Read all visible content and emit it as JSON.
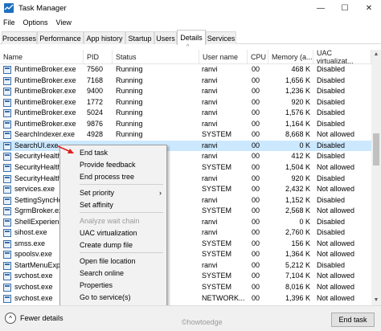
{
  "window": {
    "title": "Task Manager",
    "minimize": "—",
    "maximize": "☐",
    "close": "✕"
  },
  "menu": [
    "File",
    "Options",
    "View"
  ],
  "tabs": [
    "Processes",
    "Performance",
    "App history",
    "Startup",
    "Users",
    "Details",
    "Services"
  ],
  "active_tab": "Details",
  "columns": [
    "Name",
    "PID",
    "Status",
    "User name",
    "CPU",
    "Memory (a...",
    "UAC virtualizat..."
  ],
  "rows": [
    {
      "name": "RuntimeBroker.exe",
      "pid": "7560",
      "status": "Running",
      "user": "ranvi",
      "cpu": "00",
      "mem": "468 K",
      "uac": "Disabled"
    },
    {
      "name": "RuntimeBroker.exe",
      "pid": "7168",
      "status": "Running",
      "user": "ranvi",
      "cpu": "00",
      "mem": "1,656 K",
      "uac": "Disabled"
    },
    {
      "name": "RuntimeBroker.exe",
      "pid": "9400",
      "status": "Running",
      "user": "ranvi",
      "cpu": "00",
      "mem": "1,236 K",
      "uac": "Disabled"
    },
    {
      "name": "RuntimeBroker.exe",
      "pid": "1772",
      "status": "Running",
      "user": "ranvi",
      "cpu": "00",
      "mem": "920 K",
      "uac": "Disabled"
    },
    {
      "name": "RuntimeBroker.exe",
      "pid": "5024",
      "status": "Running",
      "user": "ranvi",
      "cpu": "00",
      "mem": "1,576 K",
      "uac": "Disabled"
    },
    {
      "name": "RuntimeBroker.exe",
      "pid": "9876",
      "status": "Running",
      "user": "ranvi",
      "cpu": "00",
      "mem": "1,164 K",
      "uac": "Disabled"
    },
    {
      "name": "SearchIndexer.exe",
      "pid": "4928",
      "status": "Running",
      "user": "SYSTEM",
      "cpu": "00",
      "mem": "8,668 K",
      "uac": "Not allowed"
    },
    {
      "name": "SearchUI.exe",
      "pid": "",
      "status": "",
      "user": "ranvi",
      "cpu": "00",
      "mem": "0 K",
      "uac": "Disabled"
    },
    {
      "name": "SecurityHealthH...",
      "pid": "",
      "status": "",
      "user": "ranvi",
      "cpu": "00",
      "mem": "412 K",
      "uac": "Disabled"
    },
    {
      "name": "SecurityHealthS...",
      "pid": "",
      "status": "",
      "user": "SYSTEM",
      "cpu": "00",
      "mem": "1,504 K",
      "uac": "Not allowed"
    },
    {
      "name": "SecurityHealthS...",
      "pid": "",
      "status": "",
      "user": "ranvi",
      "cpu": "00",
      "mem": "920 K",
      "uac": "Disabled"
    },
    {
      "name": "services.exe",
      "pid": "",
      "status": "",
      "user": "SYSTEM",
      "cpu": "00",
      "mem": "2,432 K",
      "uac": "Not allowed"
    },
    {
      "name": "SettingSyncHos...",
      "pid": "",
      "status": "",
      "user": "ranvi",
      "cpu": "00",
      "mem": "1,152 K",
      "uac": "Disabled"
    },
    {
      "name": "SgrmBroker.exe",
      "pid": "",
      "status": "",
      "user": "SYSTEM",
      "cpu": "00",
      "mem": "2,568 K",
      "uac": "Not allowed"
    },
    {
      "name": "ShellExperience...",
      "pid": "",
      "status": "",
      "user": "ranvi",
      "cpu": "00",
      "mem": "0 K",
      "uac": "Disabled"
    },
    {
      "name": "sihost.exe",
      "pid": "",
      "status": "",
      "user": "ranvi",
      "cpu": "00",
      "mem": "2,760 K",
      "uac": "Disabled"
    },
    {
      "name": "smss.exe",
      "pid": "",
      "status": "",
      "user": "SYSTEM",
      "cpu": "00",
      "mem": "156 K",
      "uac": "Not allowed"
    },
    {
      "name": "spoolsv.exe",
      "pid": "",
      "status": "",
      "user": "SYSTEM",
      "cpu": "00",
      "mem": "1,364 K",
      "uac": "Not allowed"
    },
    {
      "name": "StartMenuExpe...",
      "pid": "",
      "status": "",
      "user": "ranvi",
      "cpu": "00",
      "mem": "5,212 K",
      "uac": "Disabled"
    },
    {
      "name": "svchost.exe",
      "pid": "",
      "status": "",
      "user": "SYSTEM",
      "cpu": "00",
      "mem": "7,104 K",
      "uac": "Not allowed"
    },
    {
      "name": "svchost.exe",
      "pid": "",
      "status": "",
      "user": "SYSTEM",
      "cpu": "00",
      "mem": "8,016 K",
      "uac": "Not allowed"
    },
    {
      "name": "svchost.exe",
      "pid": "",
      "status": "",
      "user": "NETWORK...",
      "cpu": "00",
      "mem": "1,396 K",
      "uac": "Not allowed"
    }
  ],
  "context_menu": {
    "items": [
      "End task",
      "Provide feedback",
      "End process tree",
      "Set priority",
      "Set affinity",
      "Analyze wait chain",
      "UAC virtualization",
      "Create dump file",
      "Open file location",
      "Search online",
      "Properties",
      "Go to service(s)"
    ],
    "submenu_arrow": "›"
  },
  "footer": {
    "fewer_details": "Fewer details",
    "end_task": "End task"
  },
  "watermark": "©howtoedge",
  "colors": {
    "selection": "#cce8ff",
    "accent": "#1d6fbf",
    "arrow": "#e02020"
  }
}
